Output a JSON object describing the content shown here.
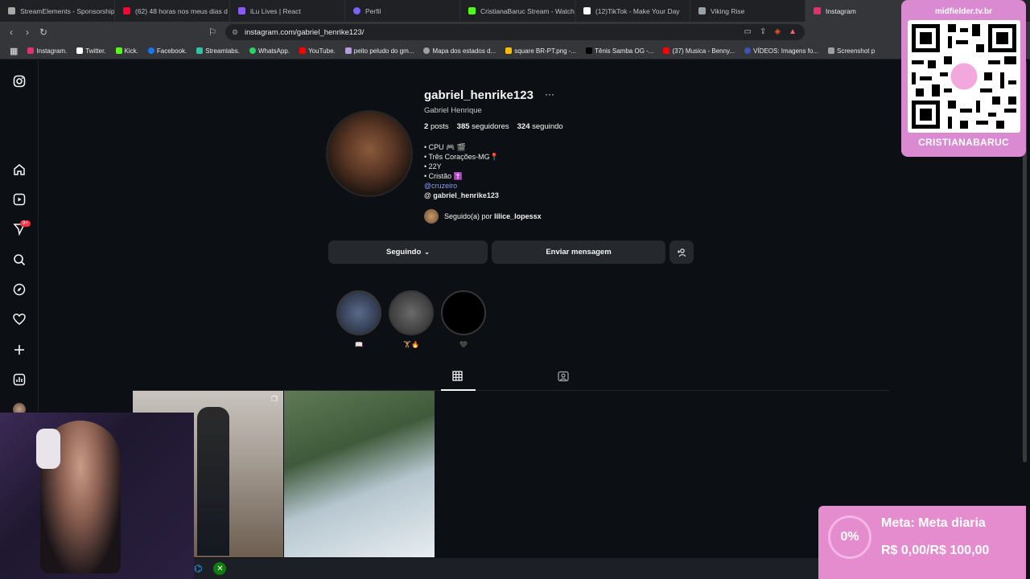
{
  "browser": {
    "tabs": [
      {
        "label": "StreamElements - Sponsorship",
        "color": "#a8a8a8"
      },
      {
        "label": "(62) 48 horas nos meus dias d",
        "color": "#ff0033"
      },
      {
        "label": "iLu Lives | React",
        "color": "#8a5cf6"
      },
      {
        "label": "Perfil",
        "color": "#7b61ff"
      },
      {
        "label": "CristianaBaruc Stream - Watch",
        "color": "#53fc18"
      },
      {
        "label": "(12)TikTok - Make Your Day",
        "color": "#ffffff"
      },
      {
        "label": "Viking Rise",
        "color": "#9aa0a6"
      },
      {
        "label": "Instagram",
        "color": "#e1306c"
      }
    ],
    "url": "instagram.com/gabriel_henrike123/",
    "bookmarks": [
      {
        "label": "Instagram.",
        "color": "#e1306c"
      },
      {
        "label": "Twitter.",
        "color": "#ffffff"
      },
      {
        "label": "Kick.",
        "color": "#53fc18"
      },
      {
        "label": "Facebook.",
        "color": "#1877f2"
      },
      {
        "label": "Streamlabs.",
        "color": "#31c3a2"
      },
      {
        "label": "WhatsApp.",
        "color": "#25d366"
      },
      {
        "label": "YouTube.",
        "color": "#ff0000"
      },
      {
        "label": "peito peludo do gm...",
        "color": "#b39ddb"
      },
      {
        "label": "Mapa dos estados d...",
        "color": "#9aa0a6"
      },
      {
        "label": "square BR-PT.png -...",
        "color": "#fbbc04"
      },
      {
        "label": "Tênis Samba OG -...",
        "color": "#000000"
      },
      {
        "label": "(37) Musica - Benny...",
        "color": "#ff0000"
      },
      {
        "label": "VÍDEOS: Imagens fo...",
        "color": "#3f51b5"
      },
      {
        "label": "Screenshot p",
        "color": "#9aa0a6"
      }
    ]
  },
  "profile": {
    "username": "gabriel_henrike123",
    "more": "···",
    "full_name": "Gabriel Henrique",
    "posts_count": "2",
    "posts_label": "posts",
    "followers_count": "385",
    "followers_label": "seguidores",
    "following_count": "324",
    "following_label": "seguindo",
    "bio": [
      "• CPU 🎮 🎬",
      "• Três Corações-MG📍",
      "• 22Y",
      "• Cristão ✝️"
    ],
    "bio_link": "@cruzeiro",
    "threads_handle": "gabriel_henrike123",
    "followed_by_prefix": "Seguido(a) por",
    "followed_by_user": "lilice_lopessx"
  },
  "actions": {
    "following_label": "Seguindo",
    "message_label": "Enviar mensagem"
  },
  "highlights": [
    {
      "label": "📖"
    },
    {
      "label": "🏋🔥"
    },
    {
      "label": "🖤"
    }
  ],
  "sidebar": {
    "notifications_badge": "9+"
  },
  "overlays": {
    "qr_site": "midfielder.tv.br",
    "qr_name": "CRISTIANABARUC",
    "goal_percent": "0%",
    "goal_title": "Meta: Meta diaria",
    "goal_value": "R$ 0,00/R$ 100,00"
  },
  "colors": {
    "ig_bg": "#0c1014",
    "button_bg": "#25292e",
    "link": "#8c9bf5",
    "overlay_pink": "#e58ccf"
  }
}
